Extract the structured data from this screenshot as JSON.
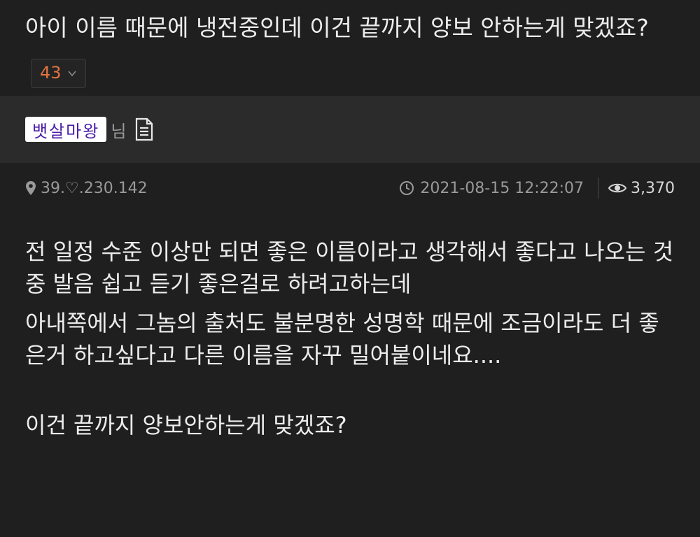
{
  "post": {
    "title": "아이 이름 때문에 냉전중인데 이건 끝까지 양보 안하는게 맞겠죠?",
    "comment_count": "43"
  },
  "author": {
    "nickname": "뱃살마왕",
    "suffix": "님"
  },
  "meta": {
    "ip": "39.♡.230.142",
    "datetime": "2021-08-15 12:22:07",
    "views": "3,370"
  },
  "body": {
    "paragraphs": [
      "전 일정 수준 이상만 되면 좋은 이름이라고 생각해서 좋다고 나오는 것 중 발음 쉽고 듣기 좋은걸로 하려고하는데",
      "아내쪽에서 그놈의 출처도 불분명한 성명학 때문에 조금이라도 더 좋은거 하고싶다고 다른 이름을 자꾸 밀어붙이네요....",
      "이건 끝까지 양보안하는게 맞겠죠?"
    ]
  },
  "colors": {
    "background": "#1f1f1f",
    "author_bar": "#2b2b2b",
    "comment_count": "#e0743f",
    "nickname_text": "#4a1da8"
  },
  "icons": [
    "chevron-down-icon",
    "document-icon",
    "location-pin-icon",
    "clock-icon",
    "eye-icon"
  ]
}
